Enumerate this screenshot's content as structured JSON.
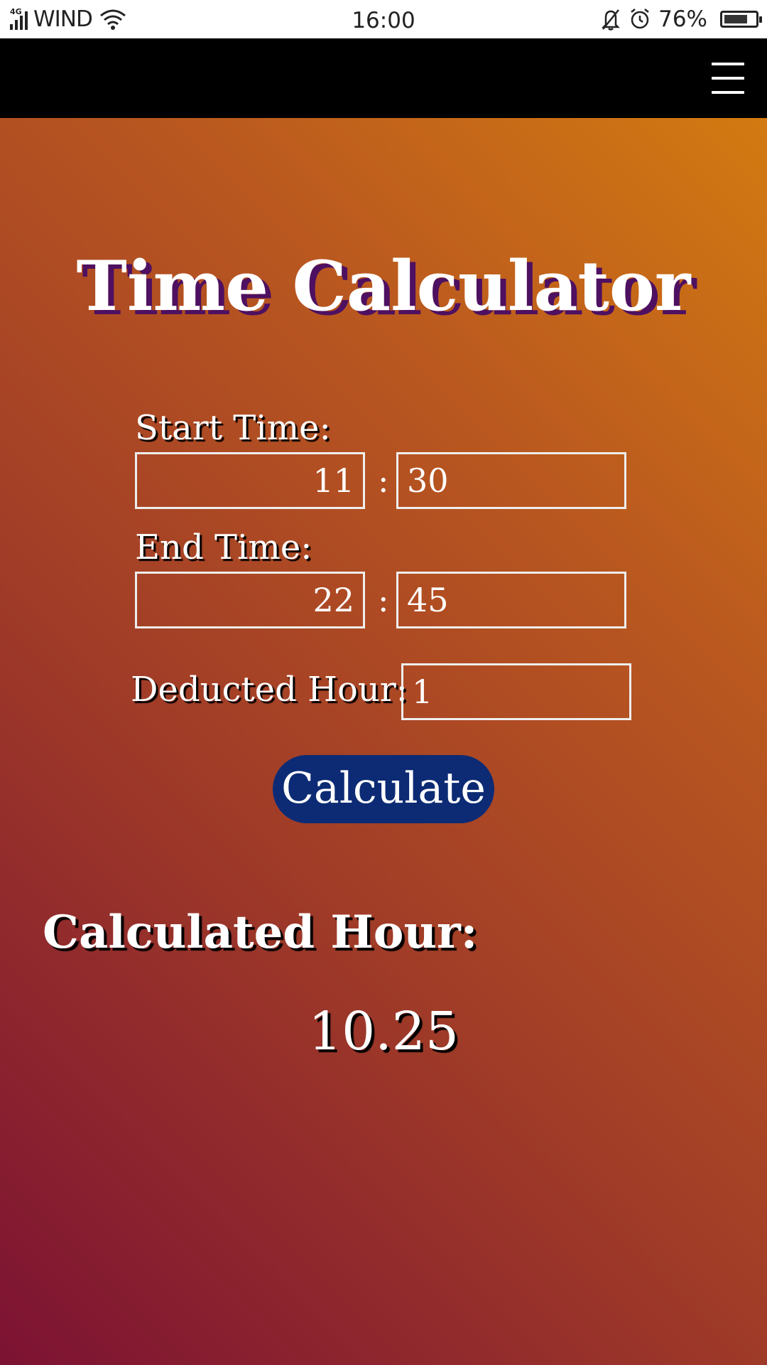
{
  "status_bar": {
    "network": "4G",
    "carrier": "WIND",
    "time": "16:00",
    "battery_percent": "76%",
    "battery_level": 0.76,
    "icons": [
      "signal-icon",
      "wifi-icon",
      "bell-off-icon",
      "alarm-icon",
      "battery-icon"
    ]
  },
  "app_bar": {
    "menu_icon": "hamburger-menu-icon"
  },
  "page": {
    "title": "Time Calculator",
    "start_label": "Start Time:",
    "start_hour": "11",
    "start_minute": "30",
    "end_label": "End Time:",
    "end_hour": "22",
    "end_minute": "45",
    "separator": ":",
    "deducted_label": "Deducted Hour:",
    "deducted_value": "1",
    "calculate_label": "Calculate",
    "result_label": "Calculated Hour:",
    "result_value": "10.25"
  },
  "colors": {
    "gradient_top_right": "#d37a11",
    "gradient_bottom_left": "#7c1233",
    "button": "#0d2b74",
    "title_shadow": "#4e1060",
    "app_bar": "#000000"
  }
}
